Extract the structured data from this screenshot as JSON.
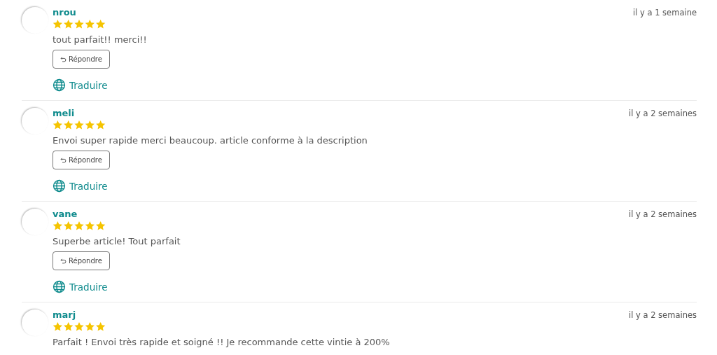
{
  "reviews": [
    {
      "name": "nrou",
      "stars": 5,
      "time": "il y a 1 semaine",
      "comment": "tout parfait!! merci!!",
      "reply_button": "Répondre",
      "translate_link": "Traduire"
    },
    {
      "name": "meli",
      "stars": 5,
      "time": "il y a 2 semaines",
      "comment": "Envoi super rapide merci beaucoup. article conforme à la description",
      "reply_button": "Répondre",
      "translate_link": "Traduire"
    },
    {
      "name": "vane",
      "stars": 5,
      "time": "il y a 2 semaines",
      "comment": "Superbe article! Tout parfait",
      "reply_button": "Répondre",
      "translate_link": "Traduire"
    },
    {
      "name": "marj",
      "stars": 5,
      "time": "il y a 2 semaines",
      "comment": "Parfait ! Envoi très rapide et soigné !! Je recommande cette vintie à 200%"
    }
  ]
}
